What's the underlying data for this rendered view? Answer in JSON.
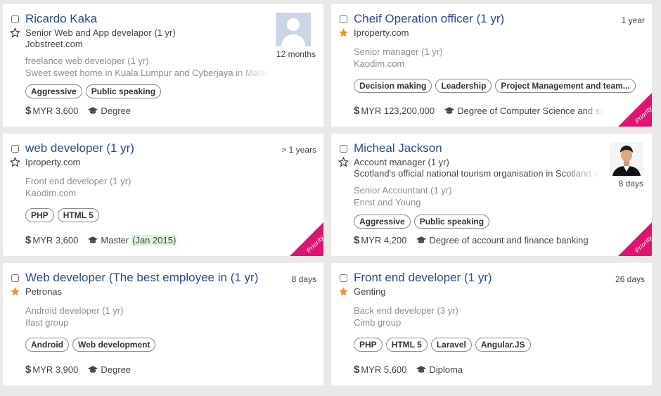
{
  "accent_title": "#2a4a8e",
  "ribbon_color": "#e01470",
  "star_filled_color": "#f0901e",
  "cards": [
    {
      "title": "Ricardo Kaka",
      "starred": false,
      "current_role": "Senior Web and App develapor (1 yr)",
      "current_company": "Jobstreet.com",
      "prev_role": "freelance web developer (1 yr)",
      "prev_company": "Sweet sweet home in Kuala Lumpur and Cyberjaya in Malaysia",
      "duration": "12 months",
      "avatar": "placeholder-avatar",
      "tags": [
        "Aggressive",
        "Public speaking"
      ],
      "salary": "MYR 3,600",
      "education": "Degree",
      "priority": false
    },
    {
      "title": "Cheif Operation officer (1 yr)",
      "starred": true,
      "current_company": "Iproperty.com",
      "prev_role": "Senior manager (1 yr)",
      "prev_company": "Kaodim.com",
      "duration": "1 year",
      "tags": [
        "Decision making",
        "Leadership",
        "Project Management and team..."
      ],
      "salary": "MYR 123,200,000",
      "education": "Degree of Computer Science and software",
      "priority": true,
      "priority_label": "Priority"
    },
    {
      "title": "web developer (1 yr)",
      "starred": false,
      "current_company": "Iproperty.com",
      "prev_role": "Front end developer (1 yr)",
      "prev_company": "Kaodim.com",
      "duration": "> 1 years",
      "tags": [
        "PHP",
        "HTML 5"
      ],
      "salary": "MYR 3,600",
      "education": "Master",
      "education_since": "(Jan 2015)",
      "priority": true,
      "priority_label": "Priority"
    },
    {
      "title": "Micheal Jackson",
      "starred": false,
      "current_role": "Account manager (1 yr)",
      "current_company": "Scotland's official national tourism organisation in Scotland and",
      "prev_role": "Senior Accountant (1 yr)",
      "prev_company": "Enrst and Young",
      "duration": "8 days",
      "avatar": "profile-photo",
      "tags": [
        "Aggressive",
        "Public speaking"
      ],
      "salary": "MYR 4,200",
      "education": "Degree of account and finance banking",
      "priority": true,
      "priority_label": "Priority"
    },
    {
      "title": "Web developer (The best employee in",
      "title_suffix": "(1 yr)",
      "starred": true,
      "current_company": "Petronas",
      "prev_role": "Android developer (1 yr)",
      "prev_company": "Ifast group",
      "duration": "8 days",
      "tags": [
        "Android",
        "Web development"
      ],
      "salary": "MYR 3,900",
      "education": "Degree",
      "priority": false
    },
    {
      "title": "Front end developer (1 yr)",
      "starred": true,
      "current_company": "Genting",
      "prev_role": "Back end developer (3 yr)",
      "prev_company": "Cimb group",
      "duration": "26 days",
      "tags": [
        "PHP",
        "HTML 5",
        "Laravel",
        "Angular.JS"
      ],
      "salary": "MYR 5,600",
      "education": "Diploma",
      "priority": false
    }
  ]
}
